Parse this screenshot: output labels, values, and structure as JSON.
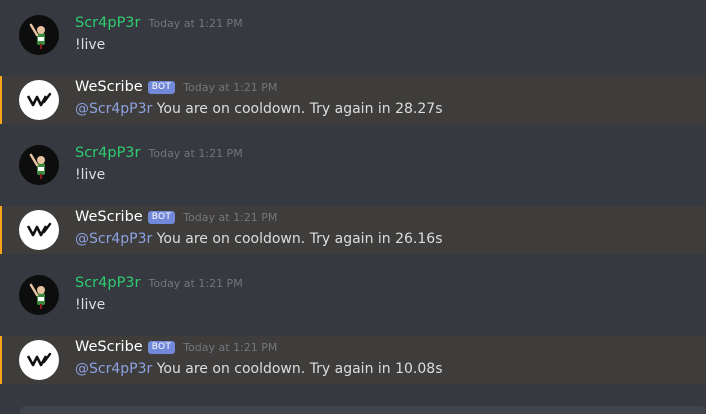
{
  "messages": [
    {
      "author": "Scr4pP3r",
      "type": "user",
      "timestamp": "Today at 1:21 PM",
      "text": "!live"
    },
    {
      "author": "WeScribe",
      "type": "bot",
      "bot_tag": "BOT",
      "timestamp": "Today at 1:21 PM",
      "mention": "@Scr4pP3r",
      "text": " You are on cooldown. Try again in 28.27s"
    },
    {
      "author": "Scr4pP3r",
      "type": "user",
      "timestamp": "Today at 1:21 PM",
      "text": "!live"
    },
    {
      "author": "WeScribe",
      "type": "bot",
      "bot_tag": "BOT",
      "timestamp": "Today at 1:21 PM",
      "mention": "@Scr4pP3r",
      "text": " You are on cooldown. Try again in 26.16s"
    },
    {
      "author": "Scr4pP3r",
      "type": "user",
      "timestamp": "Today at 1:21 PM",
      "text": "!live"
    },
    {
      "author": "WeScribe",
      "type": "bot",
      "bot_tag": "BOT",
      "timestamp": "Today at 1:21 PM",
      "mention": "@Scr4pP3r",
      "text": " You are on cooldown. Try again in 10.08s"
    }
  ],
  "colors": {
    "background": "#36393f",
    "highlight_bg": "#3e3d3b",
    "highlight_border": "#faa61a",
    "user_name": "#2ecc71",
    "bot_tag": "#7289da",
    "mention": "#8ea1e1"
  },
  "icons": {
    "user_avatar": "avatar-figure-icon",
    "bot_avatar": "wescribe-logo-icon"
  }
}
